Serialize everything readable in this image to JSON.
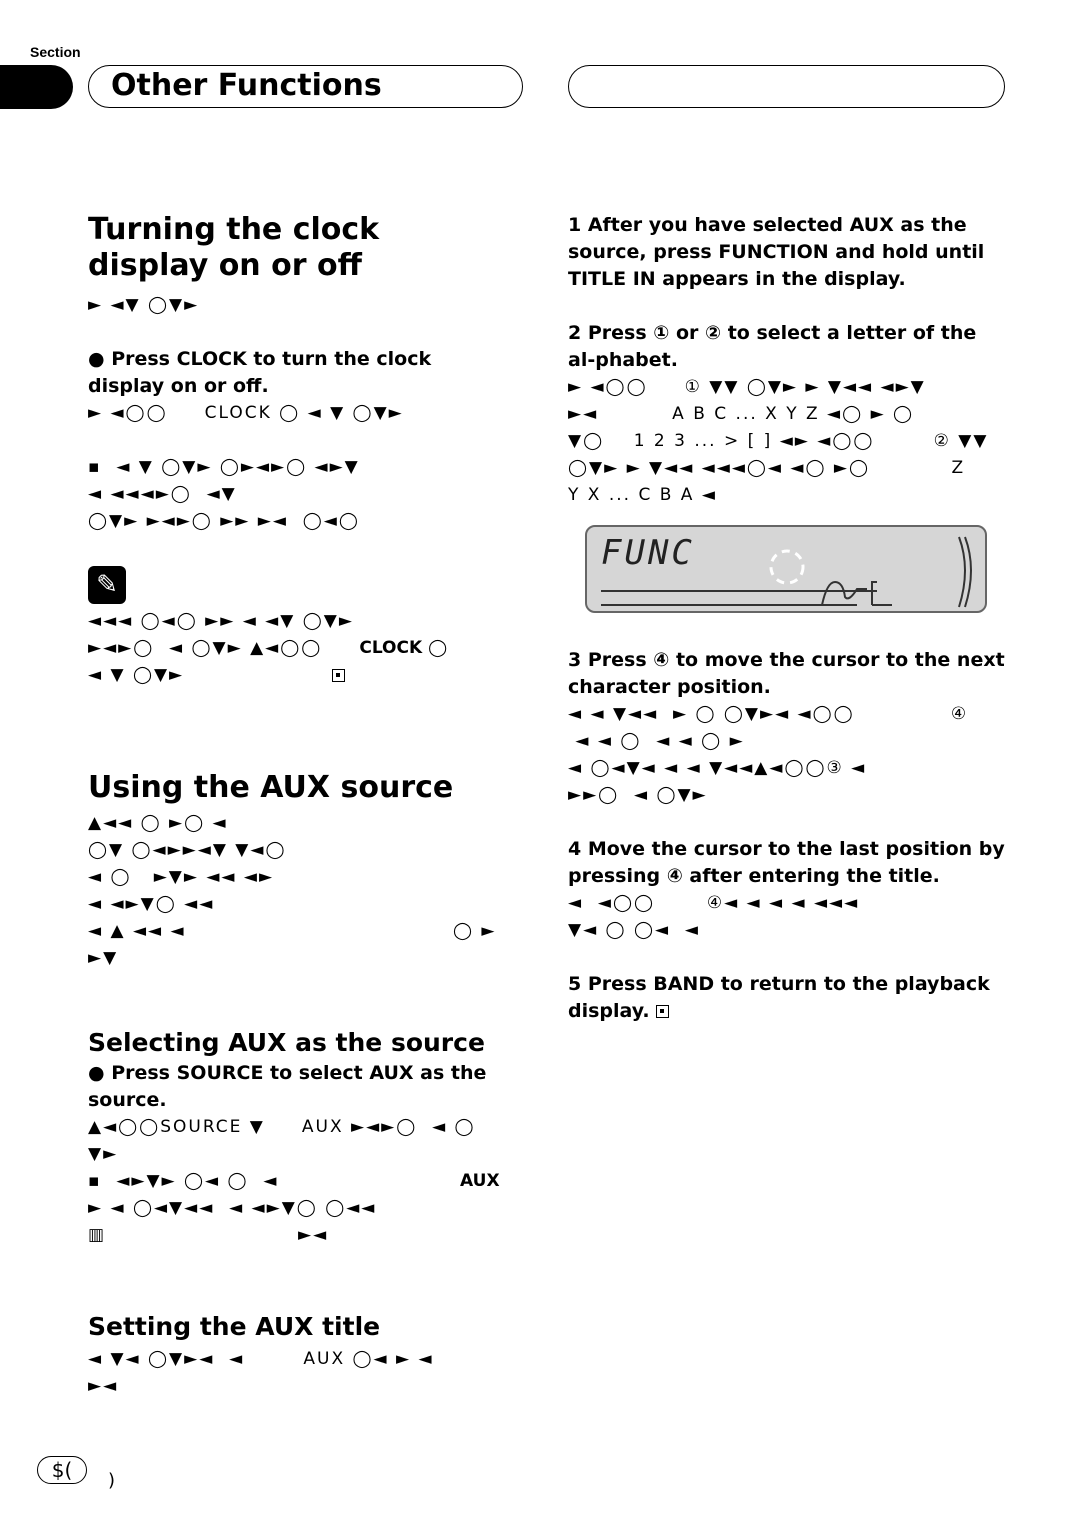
{
  "header": {
    "section_label": "Section",
    "title": "Other Functions"
  },
  "left": {
    "clock": {
      "heading": "Turning the clock display on or off",
      "g1": "► ◄▼ ◯▼►",
      "step": "● Press CLOCK to turn the clock display on or off.",
      "g2": "► ◄◯◯     CLOCK ◯ ◄ ▼ ◯▼►",
      "g3": "▪  ◄ ▼ ◯▼► ◯►◄►◯ ◄►▼",
      "g4": "◄ ◄◄◄►◯  ◄▼",
      "g5": "◯▼► ►◄►◯ ►► ►◄  ◯◄◯",
      "n1": "◄◄◄ ◯◄◯ ►► ◄ ◄▼ ◯▼►",
      "n2": "►◄►◯  ◄ ◯▼► ▲◄◯◯",
      "n2_clock": "CLOCK ◯",
      "n3": "◄ ▼ ◯▼►"
    },
    "aux": {
      "heading": "Using the AUX source",
      "g1": "▲◄◄ ◯ ►◯ ◄",
      "g2": "◯▼ ◯◄►►◄▼ ▼◄◯",
      "g3": "◄ ◯   ►▼► ◄◄ ◄►",
      "g4": "◄ ◄►▼◯ ◄◄",
      "g5": "◄ ▲ ◄◄ ◄",
      "g5r": "◯ ►",
      "g6": "►▼"
    },
    "select": {
      "heading": "Selecting AUX as the source",
      "step": "● Press SOURCE to select AUX as the source.",
      "g1": "▲◄◯◯SOURCE ▼     AUX ►◄►◯  ◄ ◯",
      "g2": "▼►",
      "g3": "▪  ◄►▼► ◯◄ ◯  ◄",
      "g3r": "AUX",
      "g4": "► ◄ ◯◄▼◄◄  ◄ ◄►▼◯ ◯◄◄",
      "g5": "▥",
      "g5r": "►◄"
    },
    "title": {
      "heading": "Setting the AUX title",
      "g1": "◄ ▼◄ ◯▼►◄  ◄        AUX ◯◄ ► ◄",
      "g2": "►◄"
    }
  },
  "right": {
    "s1": "1   After you have selected AUX as the source, press FUNCTION and hold until TITLE IN appears in the display.",
    "s2": "2   Press ① or ② to select a letter of the al-phabet.",
    "s2g1": "► ◄◯◯     ① ▼▼ ◯▼► ► ▼◄◄ ◄►▼",
    "s2g2": "►◄          A B C ... X Y Z ◄◯ ► ◯",
    "s2g3": "▼◯    1 2 3 ... > [ ] ◄► ◄◯◯        ② ▼▼",
    "s2g4": "◯▼► ► ▼◄◄ ◄◄◄◯◄ ◄◯ ►◯           Z",
    "s2g5": "Y X ... C B A ◄",
    "lcd": "FUNC",
    "s3": "3   Press ④ to move the cursor to the next character position.",
    "s3g1": "◄ ◄ ▼◄◄  ► ◯ ◯▼►◄ ◄◯◯             ④",
    "s3g2": " ◄ ◄ ◯  ◄ ◄ ◯ ►",
    "s3g3": "◄ ◯◄▼◄ ◄ ◄ ▼◄◄▲◄◯◯③ ◄",
    "s3g4": "►►◯  ◄ ◯▼►",
    "s4": "4   Move the cursor to the last position by pressing ④ after entering the title.",
    "s4g1": "◄  ◄◯◯       ④◄ ◄ ◄ ◄ ◄◄◄",
    "s4g2": "▼◄ ◯ ◯◄  ◄",
    "s5": "5   Press BAND to return to the playback display."
  },
  "footer": {
    "page_pill": "$(",
    "page_mark": ")"
  }
}
